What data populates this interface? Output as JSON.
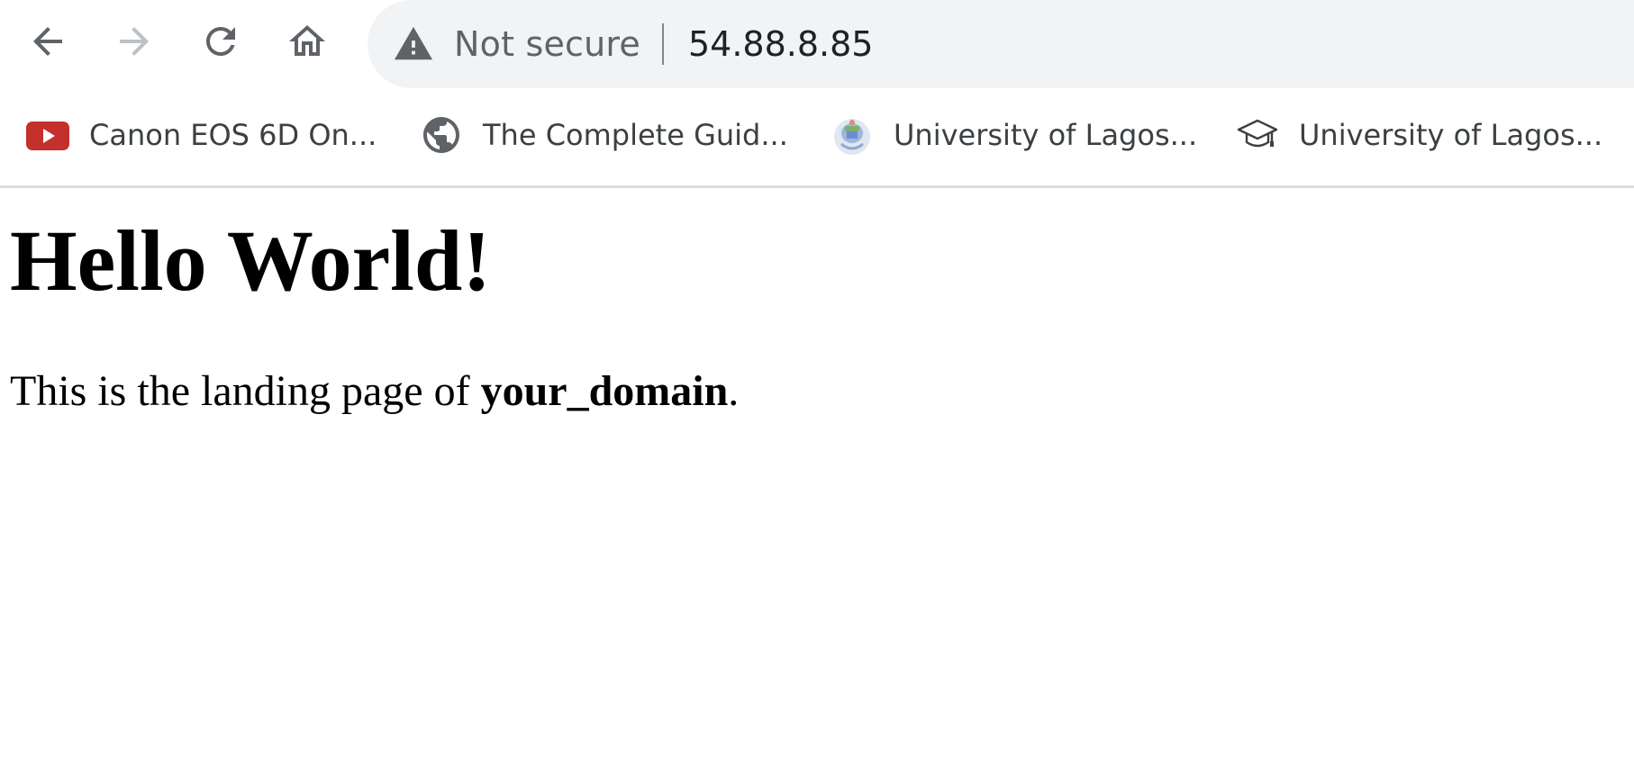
{
  "toolbar": {
    "back_icon": "arrow-left-icon",
    "forward_icon": "arrow-right-icon",
    "forward_enabled": false,
    "reload_icon": "reload-icon",
    "home_icon": "home-icon"
  },
  "omnibox": {
    "security_icon": "warning-triangle-icon",
    "security_label": "Not secure",
    "url": "54.88.8.85"
  },
  "bookmarks": [
    {
      "label": "Canon EOS 6D On...",
      "icon": "youtube-icon"
    },
    {
      "label": "The Complete Guid...",
      "icon": "globe-icon"
    },
    {
      "label": "University of Lagos...",
      "icon": "university-logo-icon"
    },
    {
      "label": "University of Lagos...",
      "icon": "graduation-cap-icon"
    }
  ],
  "page": {
    "heading": "Hello World!",
    "paragraph_prefix": "This is the landing page of ",
    "paragraph_bold": "your_domain",
    "paragraph_suffix": "."
  },
  "colors": {
    "icon_active": "#5f6368",
    "icon_disabled": "#bdc1c6",
    "omnibox_bg": "#f1f3f4",
    "youtube_red": "#c4302b"
  }
}
